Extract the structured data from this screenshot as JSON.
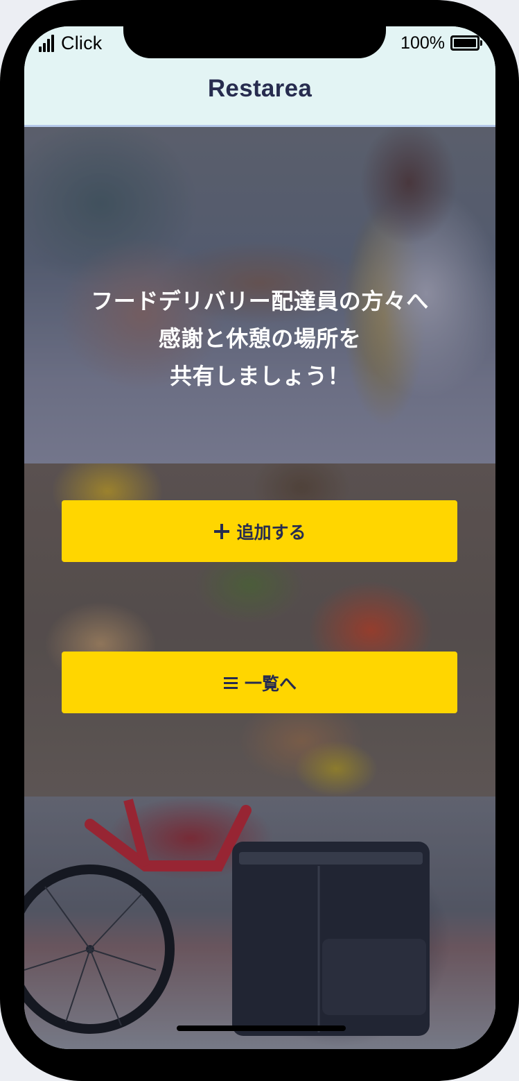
{
  "status_bar": {
    "carrier": "Click",
    "battery_percent": "100%",
    "battery_level": 1.0,
    "signal_bars": 4
  },
  "header": {
    "title": "Restarea"
  },
  "hero": {
    "lines": [
      "フードデリバリー配達員の方々へ",
      "感謝と休憩の場所を",
      "共有しましょう！"
    ]
  },
  "actions": {
    "add": {
      "icon": "plus-icon",
      "label": "追加する"
    },
    "list": {
      "icon": "menu-list-icon",
      "label": "一覧へ"
    }
  },
  "colors": {
    "header_bg": "#e3f4f4",
    "header_border": "#b5c8ea",
    "title": "#272c4f",
    "button_bg": "#ffd600",
    "button_text": "#272c4f",
    "hero_text": "#ffffff"
  },
  "images": {
    "hero": "delivery-handoff-photo",
    "middle": "food-containers-table-photo",
    "bottom": "delivery-bike-bag-photo"
  }
}
